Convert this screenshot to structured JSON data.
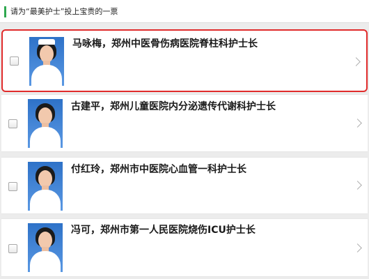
{
  "header": {
    "prompt": "请为“最美护士”投上宝贵的一票",
    "accent_color": "#2fa84f"
  },
  "candidates": [
    {
      "label": "马咏梅，郑州中医骨伤病医院脊柱科护士长",
      "checked": false,
      "highlighted": true,
      "photo_icon": "portrait-photo",
      "arrow_icon": "chevron-right-icon"
    },
    {
      "label": "古建平，郑州儿童医院内分泌遗传代谢科护士长",
      "checked": false,
      "highlighted": false,
      "photo_icon": "portrait-photo",
      "arrow_icon": "chevron-right-icon"
    },
    {
      "label": "付红玲，郑州市中医院心血管一科护士长",
      "checked": false,
      "highlighted": false,
      "photo_icon": "portrait-photo",
      "arrow_icon": "chevron-right-icon"
    },
    {
      "label": "冯可，郑州市第一人民医院烧伤ICU护士长",
      "checked": false,
      "highlighted": false,
      "photo_icon": "portrait-photo",
      "arrow_icon": "chevron-right-icon"
    }
  ],
  "colors": {
    "highlight_border": "#e02b2b",
    "photo_background": "#2e72c8"
  }
}
